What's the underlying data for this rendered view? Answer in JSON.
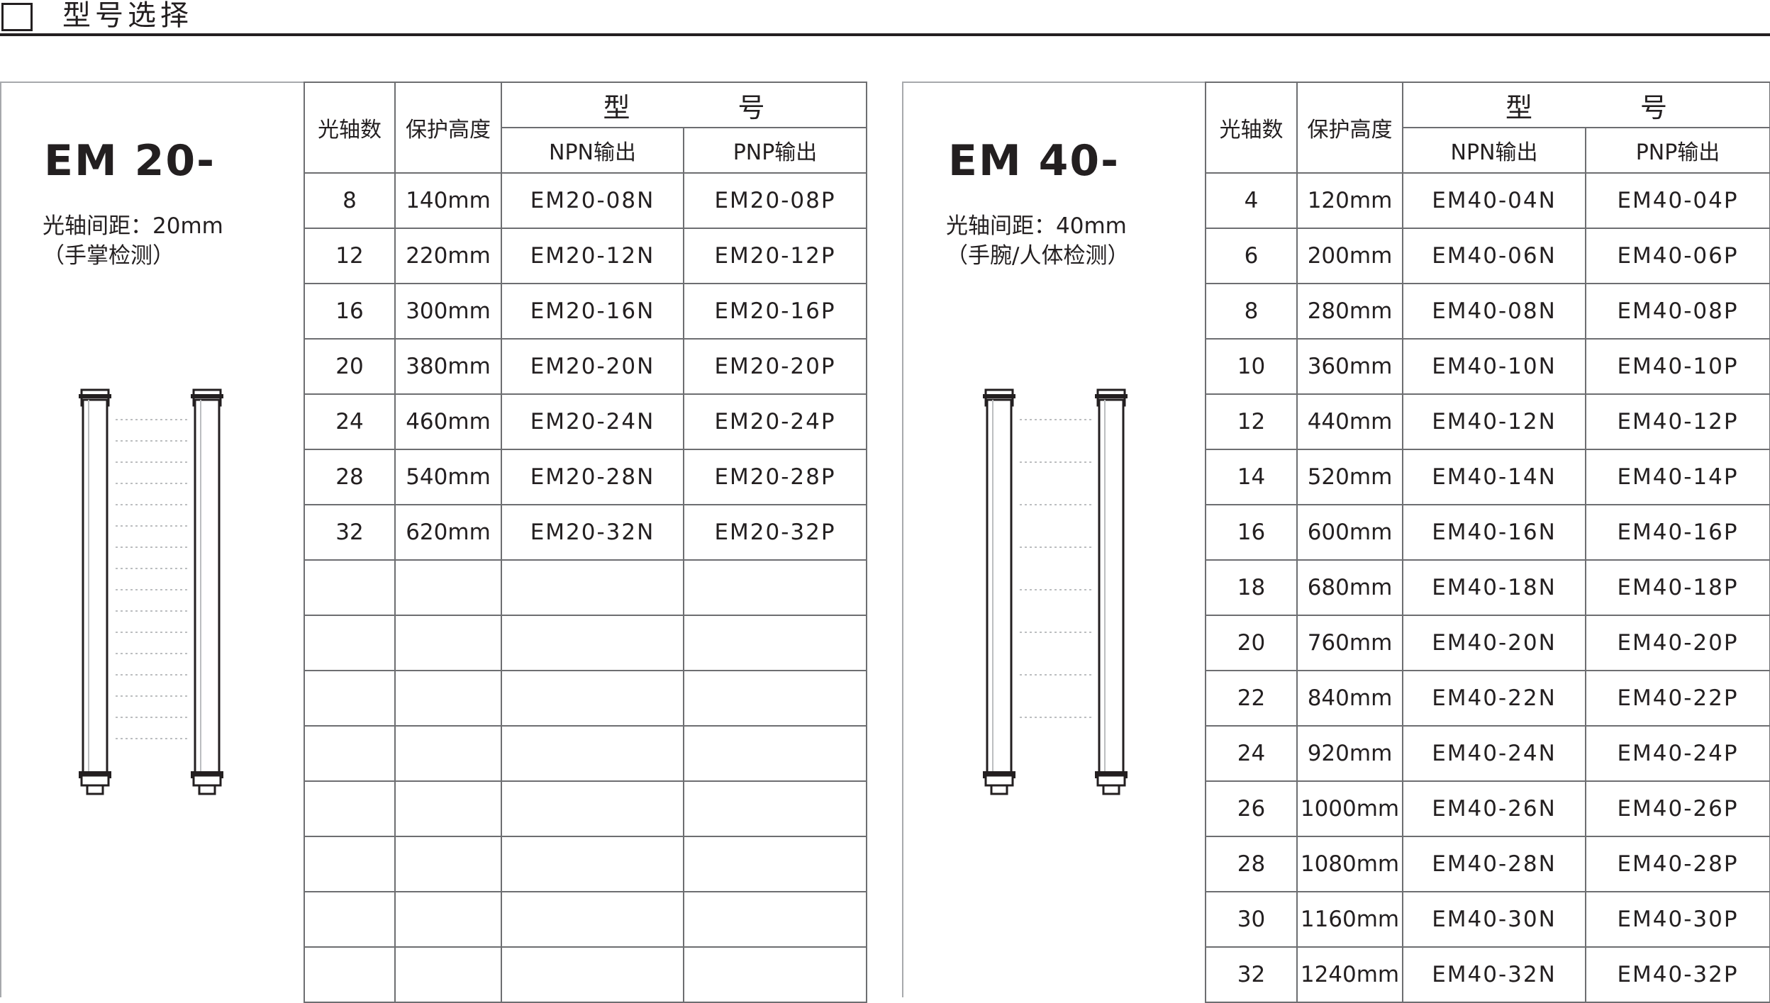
{
  "header": {
    "title": "型号选择"
  },
  "table_headers": {
    "axes": "光轴数",
    "height": "保护高度",
    "model": "型  号",
    "npn": "NPN输出",
    "pnp": "PNP输出"
  },
  "em20": {
    "series": "EM 20-",
    "pitch": "光轴间距：20mm",
    "detect": "（手掌检测）",
    "rows": [
      {
        "axes": "8",
        "height": "140mm",
        "npn": "EM20-08N",
        "pnp": "EM20-08P"
      },
      {
        "axes": "12",
        "height": "220mm",
        "npn": "EM20-12N",
        "pnp": "EM20-12P"
      },
      {
        "axes": "16",
        "height": "300mm",
        "npn": "EM20-16N",
        "pnp": "EM20-16P"
      },
      {
        "axes": "20",
        "height": "380mm",
        "npn": "EM20-20N",
        "pnp": "EM20-20P"
      },
      {
        "axes": "24",
        "height": "460mm",
        "npn": "EM20-24N",
        "pnp": "EM20-24P"
      },
      {
        "axes": "28",
        "height": "540mm",
        "npn": "EM20-28N",
        "pnp": "EM20-28P"
      },
      {
        "axes": "32",
        "height": "620mm",
        "npn": "EM20-32N",
        "pnp": "EM20-32P"
      },
      {
        "axes": "",
        "height": "",
        "npn": "",
        "pnp": ""
      },
      {
        "axes": "",
        "height": "",
        "npn": "",
        "pnp": ""
      },
      {
        "axes": "",
        "height": "",
        "npn": "",
        "pnp": ""
      },
      {
        "axes": "",
        "height": "",
        "npn": "",
        "pnp": ""
      },
      {
        "axes": "",
        "height": "",
        "npn": "",
        "pnp": ""
      },
      {
        "axes": "",
        "height": "",
        "npn": "",
        "pnp": ""
      },
      {
        "axes": "",
        "height": "",
        "npn": "",
        "pnp": ""
      },
      {
        "axes": "",
        "height": "",
        "npn": "",
        "pnp": ""
      }
    ]
  },
  "em40": {
    "series": "EM 40-",
    "pitch": "光轴间距：40mm",
    "detect": "（手腕/人体检测）",
    "rows": [
      {
        "axes": "4",
        "height": "120mm",
        "npn": "EM40-04N",
        "pnp": "EM40-04P"
      },
      {
        "axes": "6",
        "height": "200mm",
        "npn": "EM40-06N",
        "pnp": "EM40-06P"
      },
      {
        "axes": "8",
        "height": "280mm",
        "npn": "EM40-08N",
        "pnp": "EM40-08P"
      },
      {
        "axes": "10",
        "height": "360mm",
        "npn": "EM40-10N",
        "pnp": "EM40-10P"
      },
      {
        "axes": "12",
        "height": "440mm",
        "npn": "EM40-12N",
        "pnp": "EM40-12P"
      },
      {
        "axes": "14",
        "height": "520mm",
        "npn": "EM40-14N",
        "pnp": "EM40-14P"
      },
      {
        "axes": "16",
        "height": "600mm",
        "npn": "EM40-16N",
        "pnp": "EM40-16P"
      },
      {
        "axes": "18",
        "height": "680mm",
        "npn": "EM40-18N",
        "pnp": "EM40-18P"
      },
      {
        "axes": "20",
        "height": "760mm",
        "npn": "EM40-20N",
        "pnp": "EM40-20P"
      },
      {
        "axes": "22",
        "height": "840mm",
        "npn": "EM40-22N",
        "pnp": "EM40-22P"
      },
      {
        "axes": "24",
        "height": "920mm",
        "npn": "EM40-24N",
        "pnp": "EM40-24P"
      },
      {
        "axes": "26",
        "height": "1000mm",
        "npn": "EM40-26N",
        "pnp": "EM40-26P"
      },
      {
        "axes": "28",
        "height": "1080mm",
        "npn": "EM40-28N",
        "pnp": "EM40-28P"
      },
      {
        "axes": "30",
        "height": "1160mm",
        "npn": "EM40-30N",
        "pnp": "EM40-30P"
      },
      {
        "axes": "32",
        "height": "1240mm",
        "npn": "EM40-32N",
        "pnp": "EM40-32P"
      }
    ]
  }
}
